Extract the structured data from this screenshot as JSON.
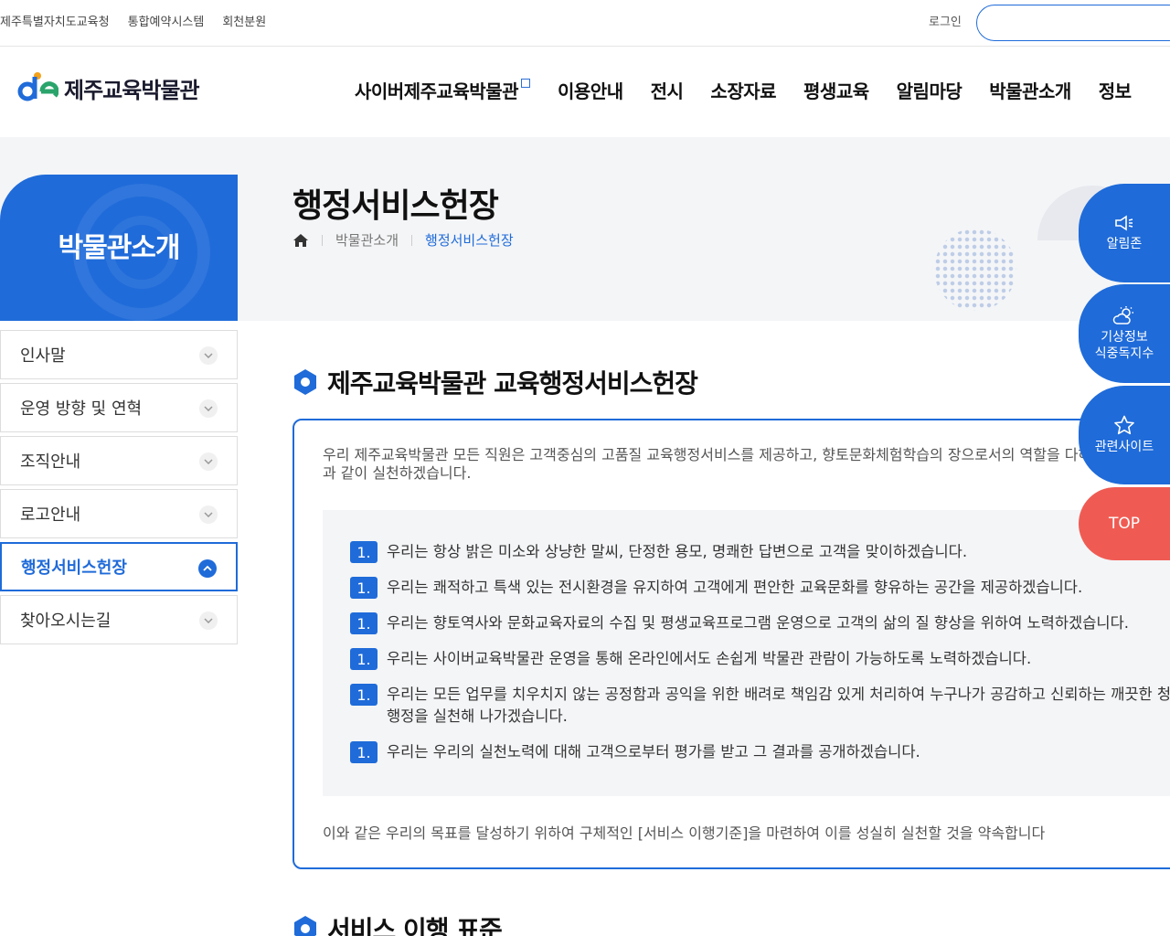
{
  "topbar": {
    "links": [
      "제주특별자치도교육청",
      "통합예약시스템",
      "회천분원"
    ],
    "login_label": "로그인",
    "search_placeholder": ""
  },
  "header": {
    "logo_text": "제주교육박물관",
    "nav": [
      "사이버제주교육박물관",
      "이용안내",
      "전시",
      "소장자료",
      "평생교육",
      "알림마당",
      "박물관소개",
      "정보"
    ]
  },
  "sub_visual": {
    "title": "박물관소개"
  },
  "page": {
    "title": "행정서비스헌장",
    "breadcrumb": [
      "박물관소개",
      "행정서비스헌장"
    ]
  },
  "lnb": {
    "items": [
      {
        "label": "인사말",
        "active": false
      },
      {
        "label": "운영 방향 및 연혁",
        "active": false
      },
      {
        "label": "조직안내",
        "active": false
      },
      {
        "label": "로고안내",
        "active": false
      },
      {
        "label": "행정서비스헌장",
        "active": true
      },
      {
        "label": "찾아오시는길",
        "active": false
      }
    ]
  },
  "charter": {
    "section_title": "제주교육박물관 교육행정서비스헌장",
    "intro": "우리 제주교육박물관 모든 직원은 고객중심의 고품질 교육행정서비스를 제공하고, 향토문화체험학습의 장으로서의 역할을 다하기 위하여 다음과 같이 실천하겠습니다.",
    "number_label": "1.",
    "pledges": [
      "우리는 항상 밝은 미소와 상냥한 말씨, 단정한 용모, 명쾌한 답변으로 고객을 맞이하겠습니다.",
      "우리는 쾌적하고 특색 있는 전시환경을 유지하여 고객에게 편안한 교육문화를 향유하는 공간을 제공하겠습니다.",
      "우리는 향토역사와 문화교육자료의 수집 및 평생교육프로그램 운영으로 고객의 삶의 질 향상을 위하여 노력하겠습니다.",
      "우리는 사이버교육박물관 운영을 통해 온라인에서도 손쉽게 박물관 관람이 가능하도록 노력하겠습니다.",
      "우리는 모든 업무를 치우치지 않는 공정함과 공익을 위한 배려로 책임감 있게 처리하여 누구나가 공감하고 신뢰하는 깨끗한 청렴행정을 실천해 나가겠습니다.",
      "우리는 우리의 실천노력에 대해 고객으로부터 평가를 받고 그 결과를 공개하겠습니다."
    ],
    "closing": "이와 같은 우리의 목표를 달성하기 위하여 구체적인 [서비스 이행기준]을 마련하여 이를 성실히 실천할 것을 약속합니다"
  },
  "section2": {
    "title": "서비스 이행 표준"
  },
  "quick_menu": {
    "items": [
      {
        "label": "알림존",
        "icon": "megaphone-icon"
      },
      {
        "label": "기상정보\n식중독지수",
        "icon": "weather-icon"
      },
      {
        "label": "관련사이트",
        "icon": "star-icon"
      }
    ],
    "top_label": "TOP"
  },
  "colors": {
    "primary": "#1f6bd9",
    "top_button": "#ef5b53",
    "band_bg": "#f4f5f7"
  }
}
